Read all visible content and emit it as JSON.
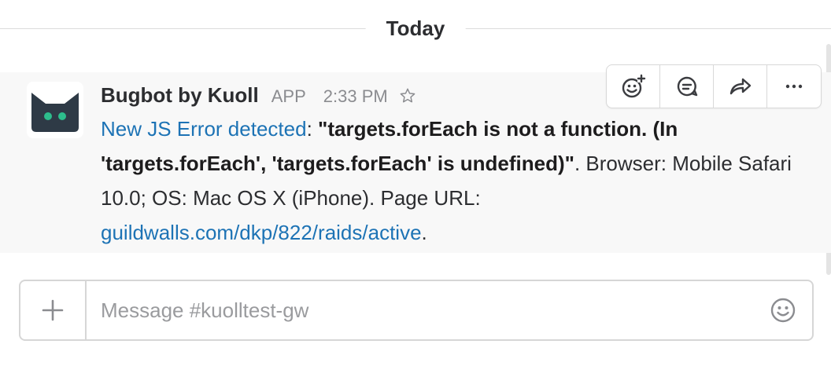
{
  "divider": {
    "label": "Today"
  },
  "message": {
    "sender": "Bugbot by Kuoll",
    "badge": "APP",
    "time": "2:33 PM",
    "link_text": "New JS Error detected",
    "colon": ": ",
    "error_text": "\"targets.forEach is not a function. (In 'targets.forEach', 'targets.forEach' is undefined)\"",
    "details": ". Browser: Mobile Safari 10.0; OS: Mac OS X (iPhone). Page URL: ",
    "url": "guildwalls.com/dkp/822/raids/active",
    "end": "."
  },
  "actions": {
    "icons": [
      "add-reaction-icon",
      "start-thread-icon",
      "share-icon",
      "more-actions-icon"
    ]
  },
  "composer": {
    "placeholder": "Message #kuolltest-gw"
  },
  "colors": {
    "link": "#1d73b5",
    "message_bg": "#f8f8f8",
    "avatar_bg": "#2e3a46",
    "avatar_eyes": "#2dbd8c",
    "muted": "#8b8c90"
  }
}
